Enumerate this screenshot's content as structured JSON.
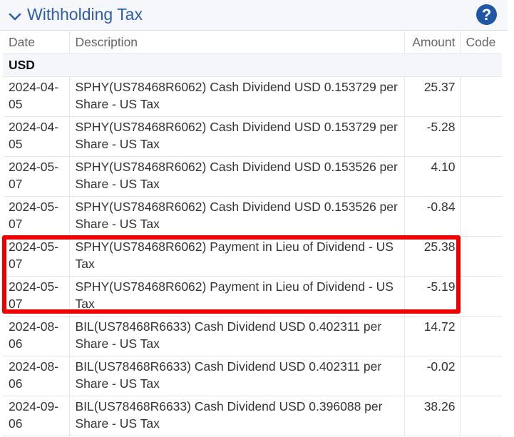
{
  "section": {
    "title": "Withholding Tax",
    "help_symbol": "?"
  },
  "columns": {
    "date": "Date",
    "description": "Description",
    "amount": "Amount",
    "code": "Code"
  },
  "group": {
    "currency": "USD"
  },
  "rows": [
    {
      "date": "2024-04-05",
      "description": "SPHY(US78468R6062) Cash Dividend USD 0.153729 per Share - US Tax",
      "amount": "25.37",
      "code": ""
    },
    {
      "date": "2024-04-05",
      "description": "SPHY(US78468R6062) Cash Dividend USD 0.153729 per Share - US Tax",
      "amount": "-5.28",
      "code": ""
    },
    {
      "date": "2024-05-07",
      "description": "SPHY(US78468R6062) Cash Dividend USD 0.153526 per Share - US Tax",
      "amount": "4.10",
      "code": ""
    },
    {
      "date": "2024-05-07",
      "description": "SPHY(US78468R6062) Cash Dividend USD 0.153526 per Share - US Tax",
      "amount": "-0.84",
      "code": ""
    },
    {
      "date": "2024-05-07",
      "description": "SPHY(US78468R6062) Payment in Lieu of Dividend - US Tax",
      "amount": "25.38",
      "code": ""
    },
    {
      "date": "2024-05-07",
      "description": "SPHY(US78468R6062) Payment in Lieu of Dividend - US Tax",
      "amount": "-5.19",
      "code": ""
    },
    {
      "date": "2024-08-06",
      "description": "BIL(US78468R6633) Cash Dividend USD 0.402311 per Share - US Tax",
      "amount": "14.72",
      "code": ""
    },
    {
      "date": "2024-08-06",
      "description": "BIL(US78468R6633) Cash Dividend USD 0.402311 per Share - US Tax",
      "amount": "-0.02",
      "code": ""
    },
    {
      "date": "2024-09-06",
      "description": "BIL(US78468R6633) Cash Dividend USD 0.396088 per Share - US Tax",
      "amount": "38.26",
      "code": ""
    }
  ],
  "colors": {
    "title": "#2f5ea8",
    "help_icon": "#1f56a6",
    "highlight_border": "#ee0000",
    "header_background": "#f5f7fa"
  },
  "icons": {
    "collapse": "chevron-down-icon",
    "help": "help-icon"
  }
}
